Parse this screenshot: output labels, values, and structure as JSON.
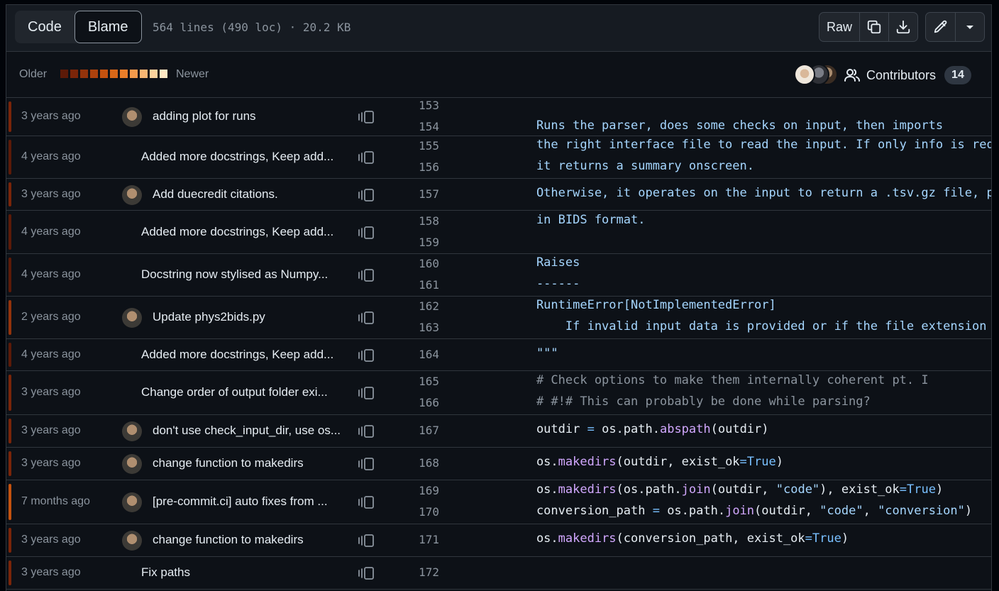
{
  "toolbar": {
    "tab_code": "Code",
    "tab_blame": "Blame",
    "file_meta": "564 lines (490 loc) · 20.2 KB",
    "raw_label": "Raw",
    "icons": [
      "copy-icon",
      "download-icon",
      "pencil-icon",
      "triangle-down-icon"
    ]
  },
  "legend": {
    "older": "Older",
    "newer": "Newer",
    "swatches": [
      "#5c1a08",
      "#7a2509",
      "#93330b",
      "#ad420d",
      "#c4520f",
      "#d86718",
      "#ea7e2a",
      "#f39a4c",
      "#f8b673",
      "#fcd39d",
      "#ffe8c4"
    ]
  },
  "contributors": {
    "label": "Contributors",
    "count": "14"
  },
  "blame": [
    {
      "age": "3 years ago",
      "avatar": true,
      "msg": "adding plot for runs",
      "bar": "#7a2509",
      "lines": [
        {
          "n": "153",
          "t": ""
        },
        {
          "n": "154",
          "t": "    Runs the parser, does some checks on input, then imports"
        }
      ]
    },
    {
      "age": "4 years ago",
      "avatar": false,
      "msg": "Added more docstrings, Keep add...",
      "bar": "#5c1a08",
      "lines": [
        {
          "n": "155",
          "t": "    the right interface file to read the input. If only info is req"
        },
        {
          "n": "156",
          "t": "    it returns a summary onscreen."
        }
      ]
    },
    {
      "age": "3 years ago",
      "avatar": true,
      "msg": "Add duecredit citations.",
      "bar": "#7a2509",
      "lines": [
        {
          "n": "157",
          "t": "    Otherwise, it operates on the input to return a .tsv.gz file, p"
        }
      ]
    },
    {
      "age": "4 years ago",
      "avatar": false,
      "msg": "Added more docstrings, Keep add...",
      "bar": "#5c1a08",
      "lines": [
        {
          "n": "158",
          "t": "    in BIDS format."
        },
        {
          "n": "159",
          "t": ""
        }
      ]
    },
    {
      "age": "4 years ago",
      "avatar": false,
      "msg": "Docstring now stylised as Numpy...",
      "bar": "#5c1a08",
      "lines": [
        {
          "n": "160",
          "t": "    Raises"
        },
        {
          "n": "161",
          "t": "    ------"
        }
      ]
    },
    {
      "age": "2 years ago",
      "avatar": true,
      "msg": "Update phys2bids.py",
      "bar": "#93330b",
      "lines": [
        {
          "n": "162",
          "t": "    RuntimeError[NotImplementedError]"
        },
        {
          "n": "163",
          "t": "        If invalid input data is provided or if the file extension i"
        }
      ]
    },
    {
      "age": "4 years ago",
      "avatar": false,
      "msg": "Added more docstrings, Keep add...",
      "bar": "#5c1a08",
      "lines": [
        {
          "n": "164",
          "t": "    \"\"\""
        }
      ]
    },
    {
      "age": "3 years ago",
      "avatar": false,
      "msg": "Change order of output folder exi...",
      "bar": "#7a2509",
      "lines": [
        {
          "n": "165",
          "t": "    # Check options to make them internally coherent pt. I"
        },
        {
          "n": "166",
          "t": "    # #!# This can probably be done while parsing?"
        }
      ]
    },
    {
      "age": "3 years ago",
      "avatar": true,
      "msg": "don't use check_input_dir, use os...",
      "bar": "#7a2509",
      "lines": [
        {
          "n": "167",
          "t": "    outdir = os.path.abspath(outdir)"
        }
      ]
    },
    {
      "age": "3 years ago",
      "avatar": true,
      "msg": "change function to makedirs",
      "bar": "#7a2509",
      "lines": [
        {
          "n": "168",
          "t": "    os.makedirs(outdir, exist_ok=True)"
        }
      ]
    },
    {
      "age": "7 months ago",
      "avatar": true,
      "msg": "[pre-commit.ci] auto fixes from ...",
      "bar": "#c4520f",
      "lines": [
        {
          "n": "169",
          "t": "    os.makedirs(os.path.join(outdir, \"code\"), exist_ok=True)"
        },
        {
          "n": "170",
          "t": "    conversion_path = os.path.join(outdir, \"code\", \"conversion\")"
        }
      ]
    },
    {
      "age": "3 years ago",
      "avatar": true,
      "msg": "change function to makedirs",
      "bar": "#7a2509",
      "lines": [
        {
          "n": "171",
          "t": "    os.makedirs(conversion_path, exist_ok=True)"
        }
      ]
    },
    {
      "age": "3 years ago",
      "avatar": false,
      "msg": "Fix paths",
      "bar": "#7a2509",
      "lines": [
        {
          "n": "172",
          "t": ""
        }
      ]
    }
  ]
}
